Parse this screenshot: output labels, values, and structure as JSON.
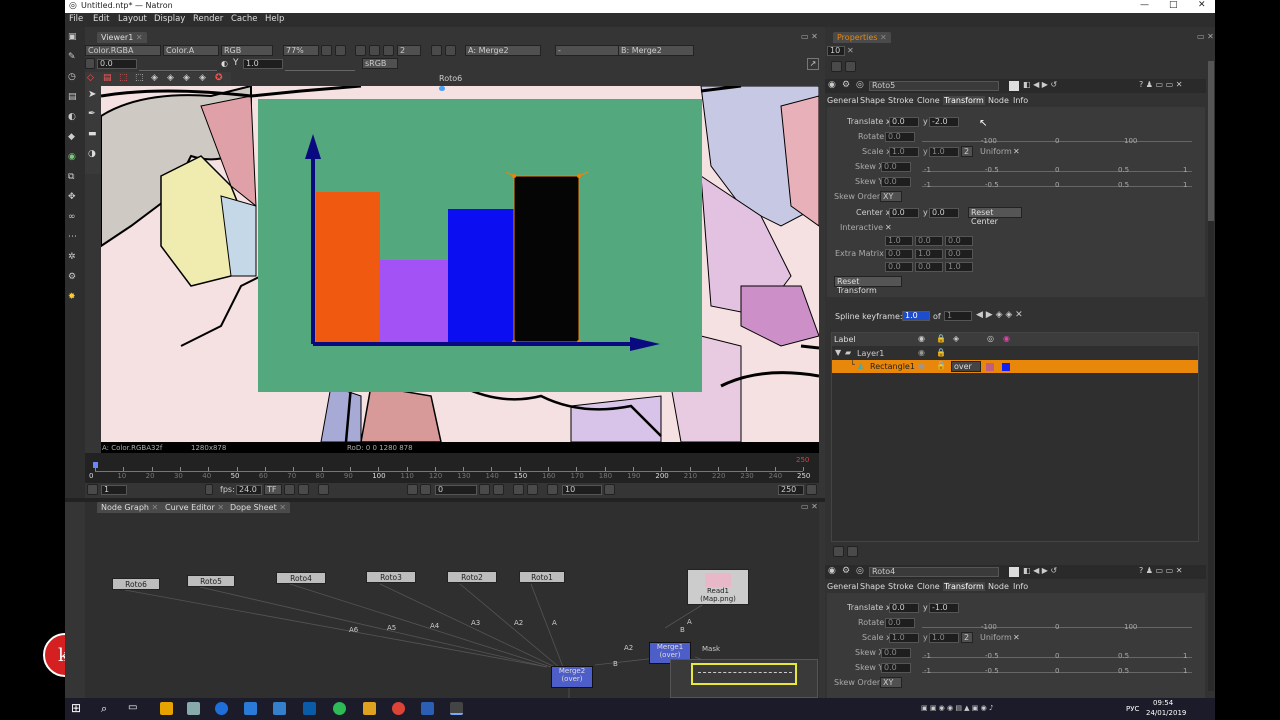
{
  "window": {
    "title": "Untitled.ntp* — Natron",
    "controls": [
      "—",
      "□",
      "✕"
    ]
  },
  "menu": [
    "File",
    "Edit",
    "Layout",
    "Display",
    "Render",
    "Cache",
    "Help"
  ],
  "viewer": {
    "tab": "Viewer1",
    "layer": "Color.RGBA",
    "alpha": "Color.A",
    "channels": "RGB",
    "zoom": "77%",
    "proxy": "2",
    "input_a": "A: Merge2",
    "input_op": "-",
    "input_b": "B: Merge2",
    "gain": "0.0",
    "gamma": "1.0",
    "gamma_label": "Y",
    "colorspace": "sRGB",
    "node_label": "Roto6",
    "info_left": "A: Color.RGBA32f",
    "info_res": "1280x878",
    "info_rod": "RoD: 0 0 1280 878"
  },
  "timeline": {
    "ticks": [
      "0",
      "10",
      "20",
      "30",
      "40",
      "50",
      "60",
      "70",
      "80",
      "90",
      "100",
      "110",
      "120",
      "130",
      "140",
      "150",
      "160",
      "170",
      "180",
      "190",
      "200",
      "210",
      "220",
      "230",
      "240",
      "250"
    ],
    "end_marker": "250",
    "start_field": "1",
    "fps_label": "fps:",
    "fps_value": "24.0",
    "tf_label": "TF",
    "current_frame": "0",
    "increment": "10",
    "end_field": "250"
  },
  "bottom_tabs": [
    "Node Graph",
    "Curve Editor",
    "Dope Sheet"
  ],
  "nodes": {
    "roto6": "Roto6",
    "roto5": "Roto5",
    "roto4": "Roto4",
    "roto3": "Roto3",
    "roto2": "Roto2",
    "roto1": "Roto1",
    "read1": "Read1",
    "read1_sub": "(Map.png)",
    "merge2": "Merge2",
    "merge2_sub": "(over)",
    "merge1": "Merge1",
    "merge1_sub": "(over)"
  },
  "edges": {
    "a6": "A6",
    "a5": "A5",
    "a4": "A4",
    "a3": "A3",
    "a2": "A2",
    "a": "A",
    "a2b": "A2",
    "b": "B",
    "a_top": "A",
    "b_top": "B",
    "mask": "Mask"
  },
  "properties": {
    "tab": "Properties",
    "max_panels": "10",
    "roto5": {
      "name": "Roto5",
      "tabs": [
        "General",
        "Shape",
        "Stroke",
        "Clone",
        "Transform",
        "Node",
        "Info"
      ],
      "translate_label": "Translate x",
      "translate_x": "0.0",
      "translate_y_label": "y",
      "translate_y": "-2.0",
      "rotate_label": "Rotate",
      "rotate": "0.0",
      "scale_label": "Scale x",
      "scale_x": "1.0",
      "scale_y_label": "y",
      "scale_y": "1.0",
      "scale_dim": "2",
      "uniform": "Uniform",
      "skewx_label": "Skew X",
      "skewx": "0.0",
      "skewy_label": "Skew Y",
      "skewy": "0.0",
      "skeworder_label": "Skew Order",
      "skeworder": "XY",
      "center_label": "Center x",
      "center_x": "0.0",
      "center_y_label": "y",
      "center_y": "0.0",
      "reset_center": "Reset Center",
      "interactive": "Interactive",
      "extra_matrix": "Extra Matrix",
      "matrix": [
        "1.0",
        "0.0",
        "0.0",
        "0.0",
        "1.0",
        "0.0",
        "0.0",
        "0.0",
        "1.0"
      ],
      "reset_transform": "Reset Transform",
      "rotate_ticks": [
        "-100",
        "0",
        "100"
      ],
      "skew_ticks": [
        "-1",
        "-0.5",
        "0",
        "0.5",
        "1"
      ],
      "spline_keyframe": "Spline keyframe:",
      "spline_value": "1.0",
      "spline_of": "of",
      "spline_total": "1",
      "tree_header": "Label",
      "layer": "Layer1",
      "shape": "Rectangle1",
      "blend": "over"
    },
    "roto4": {
      "name": "Roto4",
      "tabs": [
        "General",
        "Shape",
        "Stroke",
        "Clone",
        "Transform",
        "Node",
        "Info"
      ],
      "translate_label": "Translate x",
      "translate_x": "0.0",
      "translate_y_label": "y",
      "translate_y": "-1.0",
      "rotate_label": "Rotate",
      "rotate": "0.0",
      "scale_label": "Scale x",
      "scale_x": "1.0",
      "scale_y_label": "y",
      "scale_y": "1.0",
      "scale_dim": "2",
      "uniform": "Uniform",
      "skewx_label": "Skew X",
      "skewx": "0.0",
      "skewy_label": "Skew Y",
      "skewy": "0.0",
      "skeworder_label": "Skew Order",
      "skeworder": "XY"
    }
  },
  "taskbar": {
    "time": "09:54",
    "date": "24/01/2019",
    "lang": "РУС"
  },
  "colors": {
    "canvas_bg": "#54a87e",
    "bar1": "#f05a10",
    "bar2": "#a352f5",
    "bar3": "#0a0ef0",
    "bar4": "#050505",
    "axis": "#0a0a80",
    "selection": "#e8870a"
  }
}
